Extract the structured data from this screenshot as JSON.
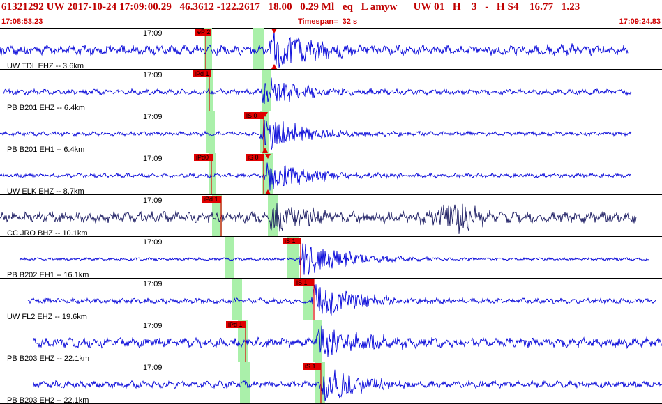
{
  "header": {
    "title": "61321292 UW 2017-10-24 17:09:00.29   46.3612 -122.2617   18.00   0.29 Ml   eq   L amyw      UW 01   H    3   -   H S4    16.77   1.23",
    "start_time": "17:08:53.23",
    "timespan": "Timespan=  32 s",
    "end_time": "17:09:24.83"
  },
  "colors": {
    "trace_blue": "#0000d8",
    "trace_dark": "#181860",
    "pick_red": "#e00000",
    "window_green": "#aaf0aa",
    "header_red": "#c00000"
  },
  "panels": [
    {
      "label": "UW TDL EHZ -- 3.6km",
      "time": "17:09",
      "trace_color": "blue",
      "picks": [
        {
          "label": "eP 2"
        }
      ],
      "marker": "triangle"
    },
    {
      "label": "PB B201 EHZ -- 6.4km",
      "time": "17:09",
      "trace_color": "blue",
      "picks": [
        {
          "label": "iPd 1"
        }
      ]
    },
    {
      "label": "PB B201 EH1 -- 6.4km",
      "time": "17:09",
      "trace_color": "blue",
      "picks": [
        {
          "label": "iS 0"
        }
      ]
    },
    {
      "label": "UW ELK EHZ -- 8.7km",
      "time": "17:09",
      "trace_color": "blue",
      "picks": [
        {
          "label": "iPd0"
        },
        {
          "label": "iS 0"
        }
      ]
    },
    {
      "label": "CC JRO BHZ -- 10.1km",
      "time": "17:09",
      "trace_color": "dark",
      "picks": [
        {
          "label": "iPd 1"
        }
      ]
    },
    {
      "label": "PB B202 EH1 -- 16.1km",
      "time": "17:09",
      "trace_color": "blue",
      "picks": [
        {
          "label": "iS 1"
        }
      ]
    },
    {
      "label": "UW FL2 EHZ -- 19.6km",
      "time": "17:09",
      "trace_color": "blue",
      "picks": [
        {
          "label": "iS 1"
        }
      ]
    },
    {
      "label": "PB B203 EHZ -- 22.1km",
      "time": "17:09",
      "trace_color": "blue",
      "picks": [
        {
          "label": "iPd 1"
        }
      ]
    },
    {
      "label": "PB B203 EH2 -- 22.1km",
      "time": "17:09",
      "trace_color": "blue",
      "picks": [
        {
          "label": "iS 1"
        }
      ]
    }
  ]
}
